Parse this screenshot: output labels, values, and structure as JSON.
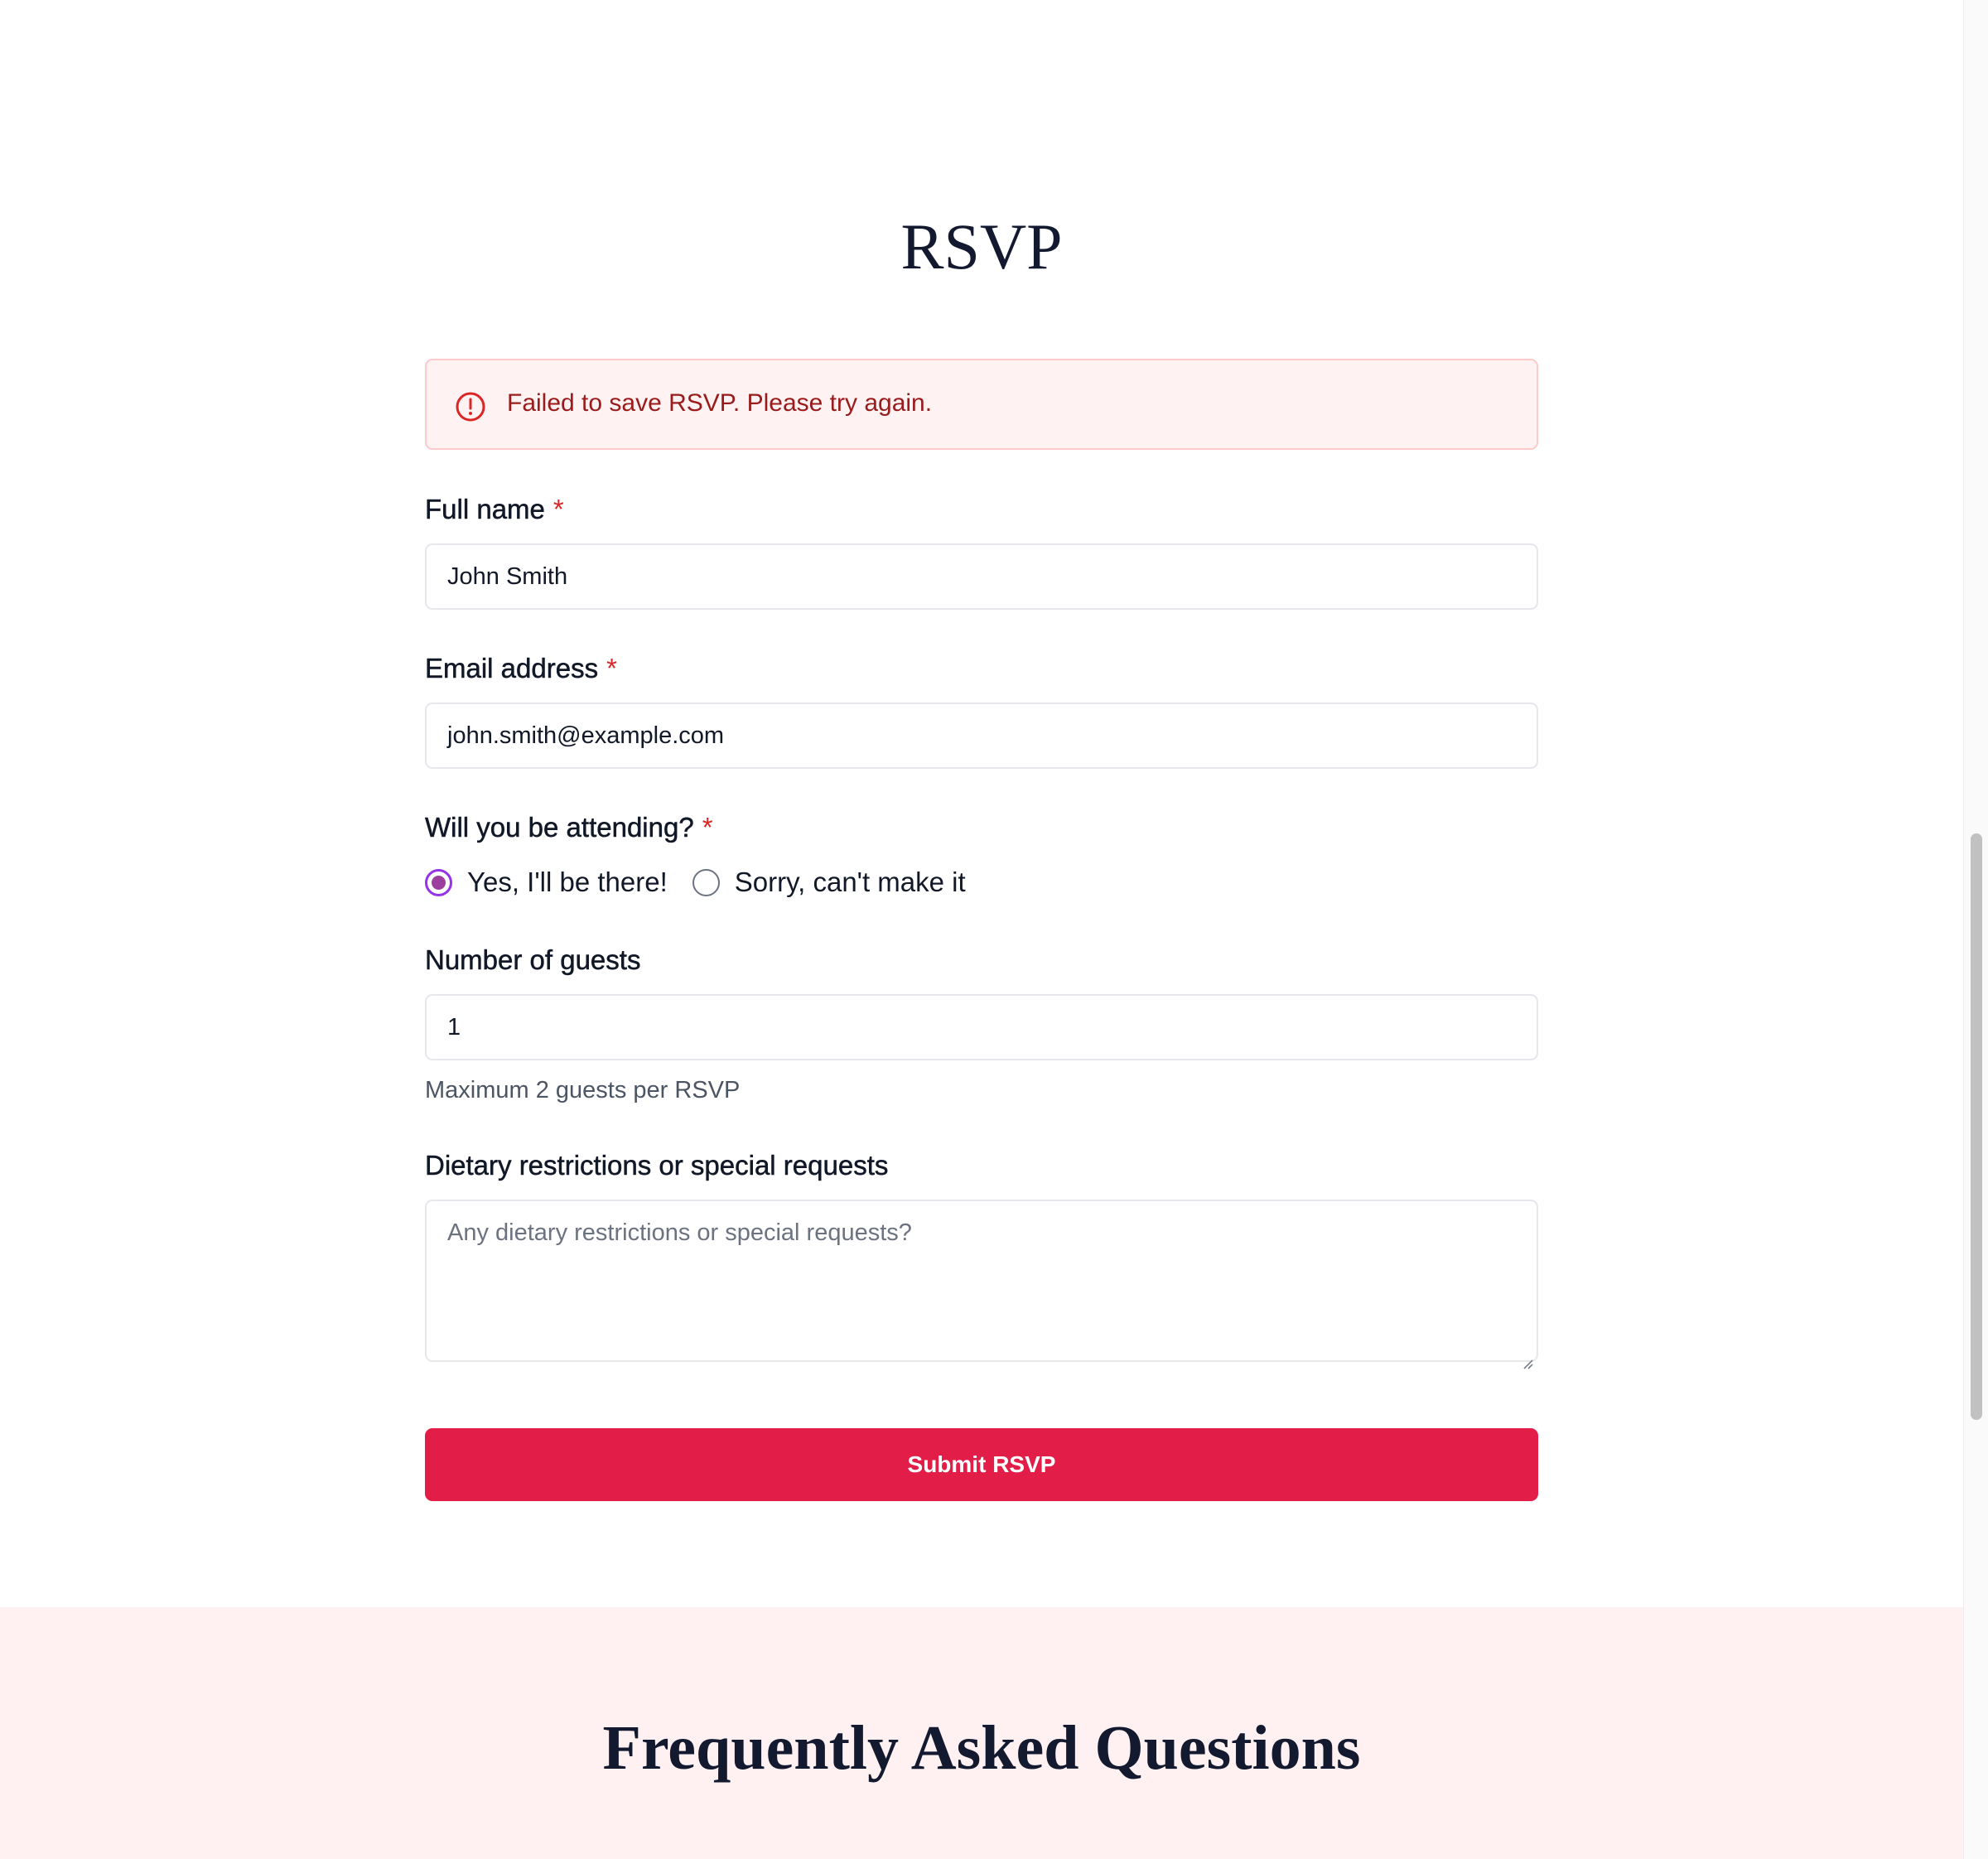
{
  "rsvp": {
    "title": "RSVP",
    "alert": {
      "message": "Failed to save RSVP. Please try again.",
      "icon": "alert-circle-icon",
      "color": "#991b1b"
    },
    "full_name": {
      "label": "Full name",
      "required_mark": "*",
      "value": "John Smith"
    },
    "email": {
      "label": "Email address",
      "required_mark": "*",
      "value": "john.smith@example.com"
    },
    "attending": {
      "label": "Will you be attending?",
      "required_mark": "*",
      "options": [
        {
          "label": "Yes, I'll be there!",
          "selected": true
        },
        {
          "label": "Sorry, can't make it",
          "selected": false
        }
      ]
    },
    "guests": {
      "label": "Number of guests",
      "value": "1",
      "hint": "Maximum 2 guests per RSVP"
    },
    "dietary": {
      "label": "Dietary restrictions or special requests",
      "placeholder": "Any dietary restrictions or special requests?",
      "value": ""
    },
    "submit_label": "Submit RSVP"
  },
  "faq": {
    "title": "Frequently Asked Questions"
  },
  "colors": {
    "accent": "#e11d48",
    "radio_selected": "#9b3e9e",
    "faq_background": "#fff1f2",
    "required": "#dc2626"
  }
}
